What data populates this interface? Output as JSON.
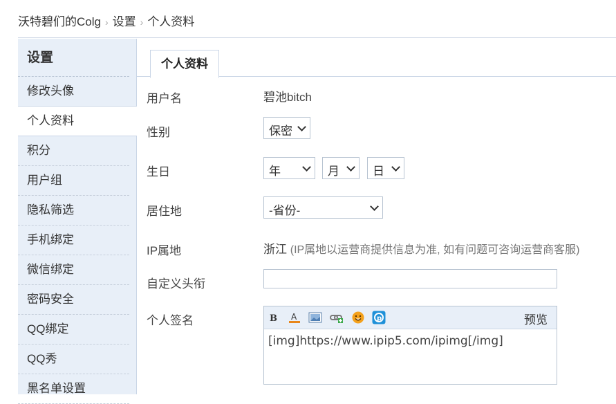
{
  "breadcrumb": {
    "home": "沃特碧们的Colg",
    "settings": "设置",
    "current": "个人资料",
    "sep": "›"
  },
  "sidebar": {
    "title": "设置",
    "items": [
      {
        "label": "修改头像"
      },
      {
        "label": "个人资料",
        "active": true
      },
      {
        "label": "积分"
      },
      {
        "label": "用户组"
      },
      {
        "label": "隐私筛选"
      },
      {
        "label": "手机绑定"
      },
      {
        "label": "微信绑定"
      },
      {
        "label": "密码安全"
      },
      {
        "label": "QQ绑定"
      },
      {
        "label": "QQ秀"
      },
      {
        "label": "黑名单设置"
      }
    ]
  },
  "tab": {
    "label": "个人资料"
  },
  "form": {
    "username": {
      "label": "用户名",
      "value": "碧池bitch"
    },
    "gender": {
      "label": "性别",
      "selected": "保密"
    },
    "birthday": {
      "label": "生日",
      "year": "年",
      "month": "月",
      "day": "日"
    },
    "residence": {
      "label": "居住地",
      "province": "-省份-"
    },
    "ip": {
      "label": "IP属地",
      "value": "浙江",
      "note": "(IP属地以运营商提供信息为准, 如有问题可咨询运营商客服)"
    },
    "custom_title": {
      "label": "自定义头衔",
      "value": ""
    },
    "signature": {
      "label": "个人签名",
      "preview_label": "预览",
      "toolbar": [
        "bold-icon",
        "font-color-icon",
        "image-icon",
        "link-icon",
        "smiley-icon",
        "app-p-icon"
      ],
      "content": "[img]https://www.ipip5.com/ipimg[/img]"
    }
  },
  "colors": {
    "sidebar_bg": "#e8eff8",
    "border": "#c9d5e6",
    "accent_orange": "#e8861a",
    "app_blue": "#1e90d8"
  }
}
